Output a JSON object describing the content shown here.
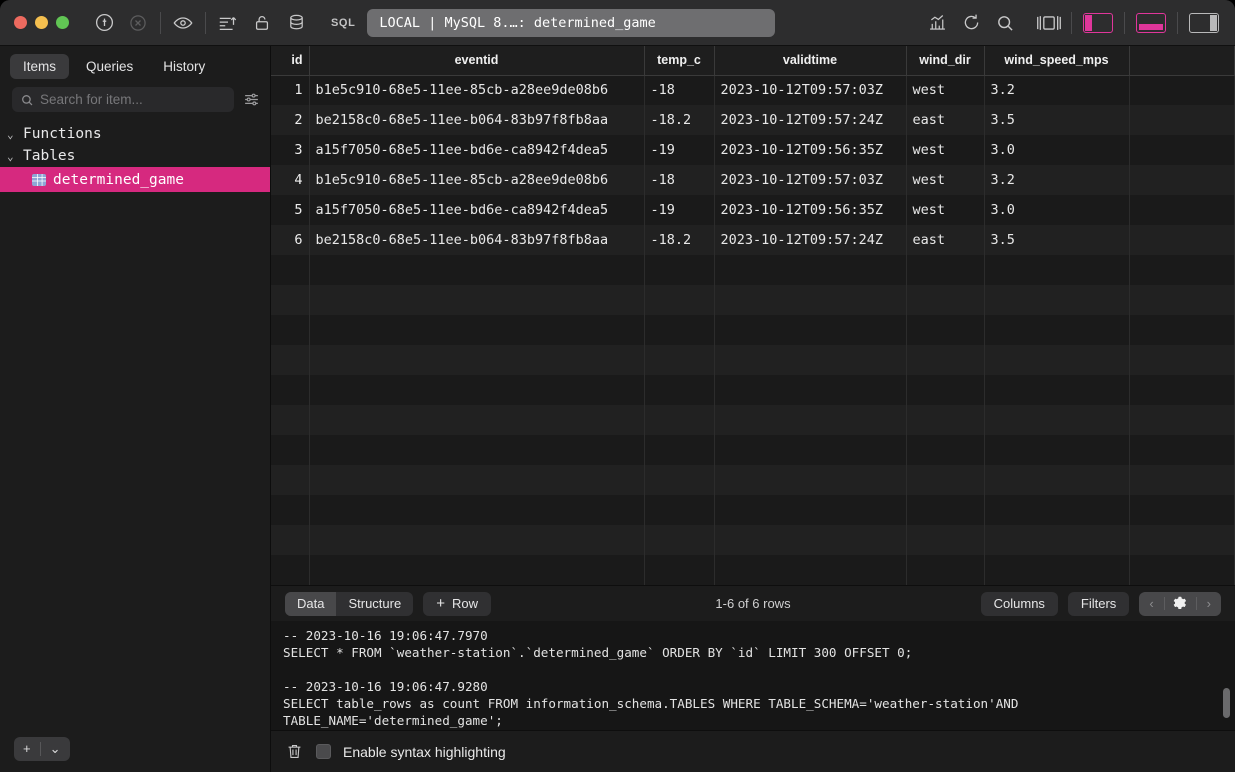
{
  "titlebar": {
    "traffic_lights": [
      "close",
      "minimize",
      "zoom"
    ],
    "sql_label": "SQL",
    "connection": "LOCAL | MySQL 8.…: determined_game",
    "icons": [
      "plug-connect-icon",
      "stop-circle-icon",
      "eye-icon",
      "sort-lines-icon",
      "lock-icon",
      "database-icon"
    ],
    "right_icons": [
      "chart-bar-icon",
      "refresh-icon",
      "search-icon",
      "center-panel-icon"
    ],
    "panel_toggles": [
      {
        "name": "left-panel-toggle",
        "active": true
      },
      {
        "name": "bottom-panel-toggle",
        "active": true
      },
      {
        "name": "right-panel-toggle",
        "active": false
      }
    ],
    "accent_color": "#e0369b"
  },
  "sidebar": {
    "tabs": [
      {
        "label": "Items",
        "active": true
      },
      {
        "label": "Queries",
        "active": false
      },
      {
        "label": "History",
        "active": false
      }
    ],
    "search": {
      "value": "",
      "placeholder": "Search for item..."
    },
    "groups": [
      {
        "label": "Functions",
        "expanded": true,
        "items": []
      },
      {
        "label": "Tables",
        "expanded": true,
        "items": [
          {
            "label": "determined_game",
            "selected": true
          }
        ]
      }
    ],
    "selection_color": "#d6297f",
    "footer": {
      "add_label": "+",
      "chevron_label": "⌄"
    }
  },
  "grid": {
    "columns": [
      "id",
      "eventid",
      "temp_c",
      "validtime",
      "wind_dir",
      "wind_speed_mps"
    ],
    "rows": [
      {
        "id": "1",
        "eventid": "b1e5c910-68e5-11ee-85cb-a28ee9de08b6",
        "temp_c": "-18",
        "validtime": "2023-10-12T09:57:03Z",
        "wind_dir": "west",
        "wind_speed_mps": "3.2"
      },
      {
        "id": "2",
        "eventid": "be2158c0-68e5-11ee-b064-83b97f8fb8aa",
        "temp_c": "-18.2",
        "validtime": "2023-10-12T09:57:24Z",
        "wind_dir": "east",
        "wind_speed_mps": "3.5"
      },
      {
        "id": "3",
        "eventid": "a15f7050-68e5-11ee-bd6e-ca8942f4dea5",
        "temp_c": "-19",
        "validtime": "2023-10-12T09:56:35Z",
        "wind_dir": "west",
        "wind_speed_mps": "3.0"
      },
      {
        "id": "4",
        "eventid": "b1e5c910-68e5-11ee-85cb-a28ee9de08b6",
        "temp_c": "-18",
        "validtime": "2023-10-12T09:57:03Z",
        "wind_dir": "west",
        "wind_speed_mps": "3.2"
      },
      {
        "id": "5",
        "eventid": "a15f7050-68e5-11ee-bd6e-ca8942f4dea5",
        "temp_c": "-19",
        "validtime": "2023-10-12T09:56:35Z",
        "wind_dir": "west",
        "wind_speed_mps": "3.0"
      },
      {
        "id": "6",
        "eventid": "be2158c0-68e5-11ee-b064-83b97f8fb8aa",
        "temp_c": "-18.2",
        "validtime": "2023-10-12T09:57:24Z",
        "wind_dir": "east",
        "wind_speed_mps": "3.5"
      }
    ]
  },
  "toolbar": {
    "data_label": "Data",
    "structure_label": "Structure",
    "add_row_plus": "+",
    "add_row_label": "Row",
    "rows_status": "1-6 of 6 rows",
    "columns_label": "Columns",
    "filters_label": "Filters",
    "prev_label": "‹",
    "next_label": "›",
    "gear_icon": "gear-icon"
  },
  "console": {
    "line1": "-- 2023-10-16 19:06:47.7970",
    "line2": "SELECT * FROM `weather-station`.`determined_game` ORDER BY `id` LIMIT 300 OFFSET 0;",
    "line3": "-- 2023-10-16 19:06:47.9280",
    "line4": "SELECT table_rows as count FROM information_schema.TABLES WHERE TABLE_SCHEMA='weather-station'AND TABLE_NAME='determined_game';"
  },
  "statusbar": {
    "trash_icon": "trash-icon",
    "syntax_checkbox_checked": false,
    "syntax_label": "Enable syntax highlighting"
  }
}
